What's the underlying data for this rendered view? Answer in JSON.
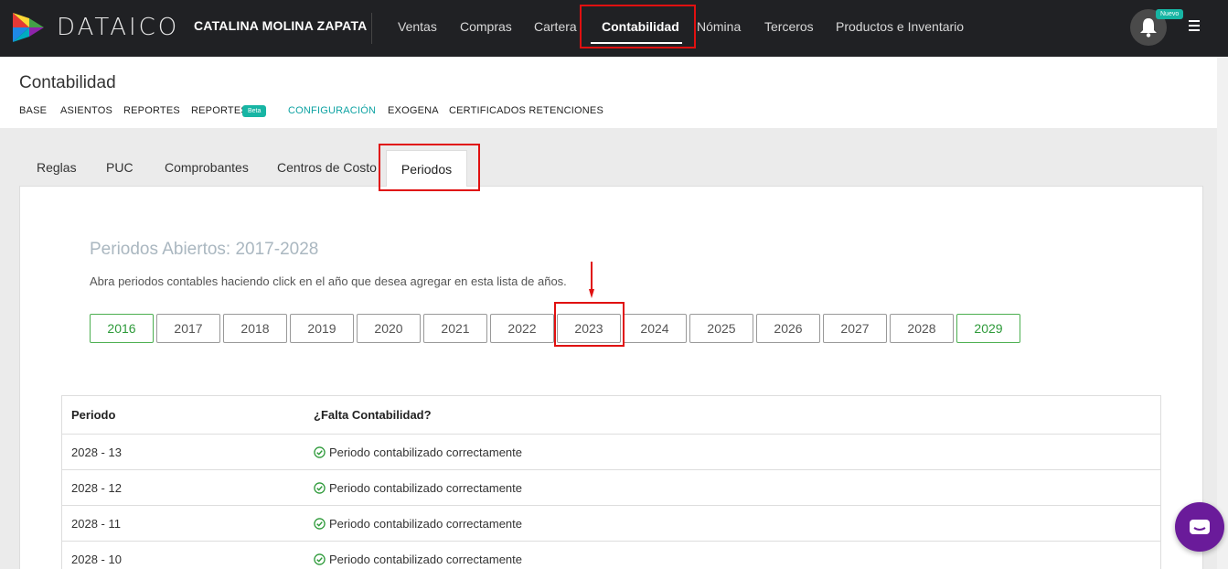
{
  "app": {
    "logo_text": "DATAICO",
    "company": "CATALINA MOLINA ZAPATA"
  },
  "topnav": {
    "items": [
      {
        "label": "Ventas"
      },
      {
        "label": "Compras"
      },
      {
        "label": "Cartera"
      },
      {
        "label": "Contabilidad",
        "active": true
      },
      {
        "label": "Nómina"
      },
      {
        "label": "Terceros"
      },
      {
        "label": "Productos e Inventario"
      }
    ],
    "new_badge": "Nuevo"
  },
  "subheader": {
    "title": "Contabilidad",
    "items": [
      {
        "label": "BASE"
      },
      {
        "label": "ASIENTOS"
      },
      {
        "label": "REPORTES"
      },
      {
        "label": "REPORTES"
      },
      {
        "label": "CONFIGURACIÓN",
        "active": true
      },
      {
        "label": "EXOGENA"
      },
      {
        "label": "CERTIFICADOS RETENCIONES"
      }
    ],
    "beta_badge": "Beta"
  },
  "tabs": [
    {
      "label": "Reglas"
    },
    {
      "label": "PUC"
    },
    {
      "label": "Comprobantes"
    },
    {
      "label": "Centros de Costo"
    },
    {
      "label": "Periodos",
      "active": true
    }
  ],
  "periods": {
    "title": "Periodos Abiertos: 2017-2028",
    "description": "Abra periodos contables haciendo click en el año que desea agregar en esta lista de años.",
    "years": [
      "2016",
      "2017",
      "2018",
      "2019",
      "2020",
      "2021",
      "2022",
      "2023",
      "2024",
      "2025",
      "2026",
      "2027",
      "2028",
      "2029"
    ],
    "green_years": [
      "2016",
      "2029"
    ]
  },
  "table": {
    "headers": [
      "Periodo",
      "¿Falta Contabilidad?"
    ],
    "rows": [
      {
        "period": "2028 - 13",
        "status": "Periodo contabilizado correctamente"
      },
      {
        "period": "2028 - 12",
        "status": "Periodo contabilizado correctamente"
      },
      {
        "period": "2028 - 11",
        "status": "Periodo contabilizado correctamente"
      },
      {
        "period": "2028 - 10",
        "status": "Periodo contabilizado correctamente"
      }
    ]
  },
  "colors": {
    "accent_teal": "#17b5a4",
    "highlight_red": "#e01010",
    "success_green": "#2e9a3a",
    "chat_purple": "#6a1b9a"
  }
}
